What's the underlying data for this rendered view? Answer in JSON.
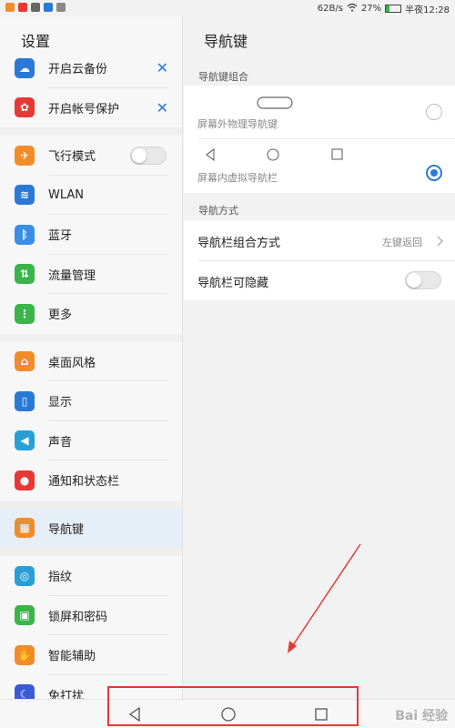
{
  "status_bar": {
    "speed": "62B/s",
    "battery_percent": "27%",
    "time": "半夜12:28",
    "battery_level": 0.27
  },
  "left_panel": {
    "title": "设置",
    "items": [
      {
        "label": "开启云备份",
        "icon": "cloud-backup-icon",
        "color": "#2a79d6",
        "trailing": "close"
      },
      {
        "label": "开启帐号保护",
        "icon": "huawei-icon",
        "color": "#e53935",
        "trailing": "close"
      },
      {
        "label": "飞行模式",
        "icon": "airplane-icon",
        "color": "#f28c28",
        "trailing": "toggle",
        "toggle_on": false
      },
      {
        "label": "WLAN",
        "icon": "wifi-icon",
        "color": "#2a79d6"
      },
      {
        "label": "蓝牙",
        "icon": "bluetooth-icon",
        "color": "#3a8ee6"
      },
      {
        "label": "流量管理",
        "icon": "data-usage-icon",
        "color": "#3ab54a"
      },
      {
        "label": "更多",
        "icon": "more-icon",
        "color": "#3ab54a"
      },
      {
        "label": "桌面风格",
        "icon": "home-style-icon",
        "color": "#f28c28"
      },
      {
        "label": "显示",
        "icon": "display-icon",
        "color": "#2a79d6"
      },
      {
        "label": "声音",
        "icon": "sound-icon",
        "color": "#2a9fd6"
      },
      {
        "label": "通知和状态栏",
        "icon": "notification-icon",
        "color": "#e53935"
      },
      {
        "label": "导航键",
        "icon": "nav-key-icon",
        "color": "#f28c28",
        "active": true
      },
      {
        "label": "指纹",
        "icon": "fingerprint-icon",
        "color": "#2a9fd6"
      },
      {
        "label": "锁屏和密码",
        "icon": "lock-icon",
        "color": "#3ab54a"
      },
      {
        "label": "智能辅助",
        "icon": "hand-icon",
        "color": "#f28c28"
      },
      {
        "label": "免打扰",
        "icon": "moon-icon",
        "color": "#3a5ad6"
      }
    ]
  },
  "right_panel": {
    "title": "导航键",
    "section1_header": "导航键组合",
    "option1_label": "屏幕外物理导航键",
    "option2_label": "屏幕内虚拟导航栏",
    "option2_selected": true,
    "section2_header": "导航方式",
    "combo_label": "导航栏组合方式",
    "combo_value": "左键返回",
    "hide_label": "导航栏可隐藏",
    "hide_toggle_on": false
  },
  "nav_bar": {
    "back": "back-icon",
    "home": "home-icon",
    "recents": "recents-icon"
  },
  "watermark": "Bai 经验",
  "colors": {
    "accent": "#2a79d6",
    "annotation": "#e53935"
  }
}
